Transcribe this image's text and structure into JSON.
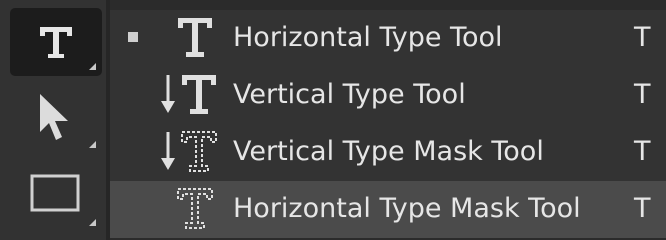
{
  "toolbar": {
    "tools": [
      {
        "name": "type-tool",
        "icon": "type-icon",
        "active": true
      },
      {
        "name": "move-tool",
        "icon": "arrow-cursor-icon",
        "active": false
      },
      {
        "name": "rectangle-tool",
        "icon": "rectangle-icon",
        "active": false
      }
    ]
  },
  "menu": {
    "items": [
      {
        "label": "Horizontal Type Tool",
        "shortcut": "T",
        "icon": "horizontal-type-icon",
        "selected": true
      },
      {
        "label": "Vertical Type Tool",
        "shortcut": "T",
        "icon": "vertical-type-icon",
        "selected": false
      },
      {
        "label": "Vertical Type Mask Tool",
        "shortcut": "T",
        "icon": "vertical-type-mask-icon",
        "selected": false
      },
      {
        "label": "Horizontal Type Mask Tool",
        "shortcut": "T",
        "icon": "horizontal-type-mask-icon",
        "selected": false,
        "hovered": true
      }
    ]
  },
  "colors": {
    "toolbar_bg": "#323232",
    "menu_bg": "#333333",
    "hover_bg": "#4b4b4b",
    "text": "#e6e6e6"
  }
}
